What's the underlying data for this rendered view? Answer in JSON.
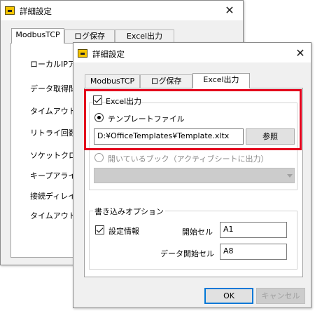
{
  "back_window": {
    "title": "詳細設定",
    "close": "✕",
    "tabs": [
      "ModbusTCP",
      "ログ保存",
      "Excel出力"
    ],
    "labels": [
      "ローカルIPア",
      "データ取得間",
      "タイムアウト",
      "リトライ回数",
      "ソケットクロ",
      "キープアライ",
      "接続ディレイ",
      "タイムアウト"
    ]
  },
  "front_window": {
    "title": "詳細設定",
    "close": "✕",
    "tabs": [
      "ModbusTCP",
      "ログ保存",
      "Excel出力"
    ],
    "excel_output": {
      "checkbox_label": "Excel出力",
      "template_radio_label": "テンプレートファイル",
      "template_path": "D:¥OfficeTemplates¥Template.xltx",
      "browse_button": "参照",
      "open_book_radio_label": "開いているブック（アクティブシートに出力）",
      "combo_value": ""
    },
    "write_options": {
      "title": "書き込みオプション",
      "setting_info_label": "設定情報",
      "start_cell_label": "開始セル",
      "start_cell_value": "A1",
      "data_start_cell_label": "データ開始セル",
      "data_start_cell_value": "A8"
    },
    "ok_button": "OK",
    "cancel_button": "キャンセル"
  }
}
